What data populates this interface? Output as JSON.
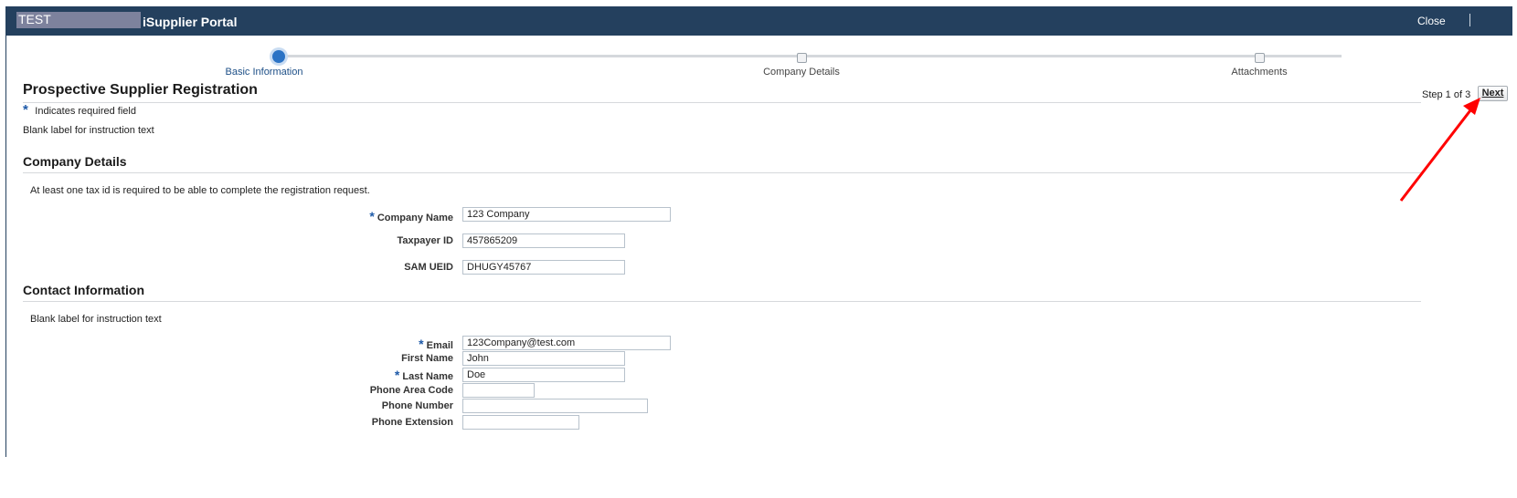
{
  "header": {
    "brand_test": "TEST",
    "app_title": "iSupplier Portal",
    "close_label": "Close"
  },
  "train": {
    "steps": [
      {
        "label": "Basic Information",
        "state": "current"
      },
      {
        "label": "Company Details",
        "state": "upcoming"
      },
      {
        "label": "Attachments",
        "state": "upcoming"
      }
    ]
  },
  "page": {
    "title": "Prospective Supplier Registration",
    "step_indicator": "Step 1 of 3",
    "next_label": "Next",
    "required_star": "*",
    "required_note": "Indicates required field",
    "instruction": "Blank label for instruction text"
  },
  "company": {
    "heading": "Company Details",
    "note": "At least one tax id is required to be able to complete the registration request.",
    "fields": {
      "company_name": {
        "label": "Company Name",
        "value": "123 Company",
        "required": true
      },
      "taxpayer_id": {
        "label": "Taxpayer ID",
        "value": "457865209",
        "required": false
      },
      "sam_ueid": {
        "label": "SAM UEID",
        "value": "DHUGY45767",
        "required": false
      }
    }
  },
  "contact": {
    "heading": "Contact Information",
    "note": "Blank label for instruction text",
    "fields": {
      "email": {
        "label": "Email",
        "value": "123Company@test.com",
        "required": true
      },
      "first_name": {
        "label": "First Name",
        "value": "John",
        "required": false
      },
      "last_name": {
        "label": "Last Name",
        "value": "Doe",
        "required": true
      },
      "phone_area_code": {
        "label": "Phone Area Code",
        "value": "",
        "required": false
      },
      "phone_number": {
        "label": "Phone Number",
        "value": "",
        "required": false
      },
      "phone_extension": {
        "label": "Phone Extension",
        "value": "",
        "required": false
      }
    }
  },
  "colors": {
    "header_bg": "#24405e",
    "accent_blue": "#2b73c5",
    "annotation_arrow": "#ff0000"
  }
}
